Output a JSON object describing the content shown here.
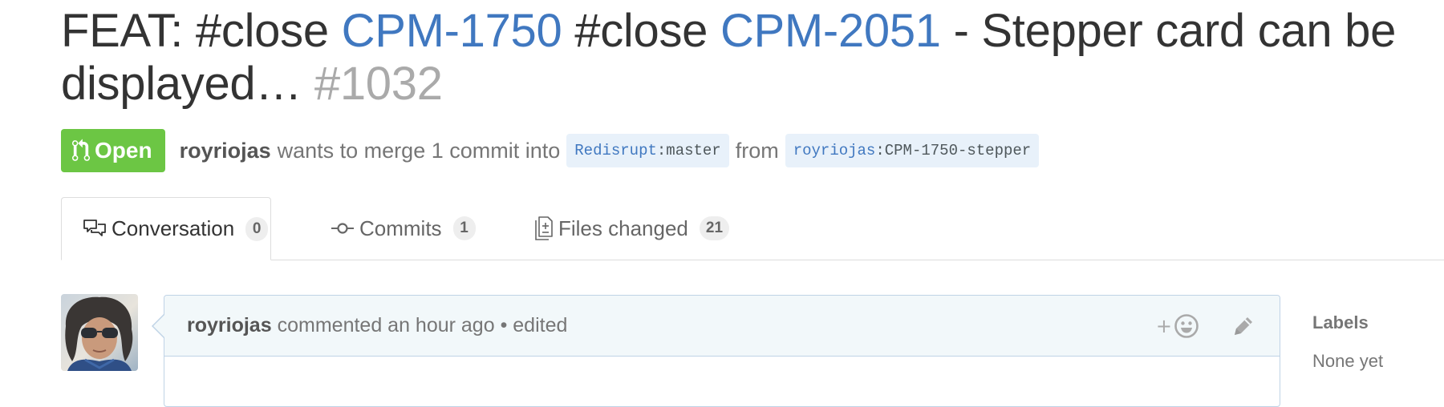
{
  "pull_request": {
    "title": {
      "part1": "FEAT: #close ",
      "link1": "CPM-1750",
      "part2": " #close ",
      "link2": "CPM-2051",
      "part3": " - Stepper card can be displayed…",
      "number": "#1032"
    },
    "state": {
      "label": "Open",
      "icon": "git-pull-request-icon",
      "color": "#6cc644"
    },
    "meta": {
      "author": "royriojas",
      "text_merge": "wants to merge 1 commit into",
      "base_user": "Redisrupt",
      "base_sep": ":",
      "base_branch": "master",
      "text_from": "from",
      "head_user": "royriojas",
      "head_sep": ":",
      "head_branch": "CPM-1750-stepper"
    }
  },
  "tabs": [
    {
      "label": "Conversation",
      "count": "0",
      "icon": "comment-discussion-icon",
      "selected": true
    },
    {
      "label": "Commits",
      "count": "1",
      "icon": "git-commit-icon",
      "selected": false
    },
    {
      "label": "Files changed",
      "count": "21",
      "icon": "file-diff-icon",
      "selected": false
    }
  ],
  "comment": {
    "author": "royriojas",
    "text": "commented an hour ago • edited",
    "reaction_icon": "smiley-icon",
    "reaction_plus": "+",
    "edit_icon": "pencil-icon"
  },
  "sidebar": {
    "labels_heading": "Labels",
    "labels_value": "None yet"
  },
  "colors": {
    "link": "#4078c0",
    "open_badge": "#6cc644",
    "comment_header_bg": "#f2f8fa",
    "comment_border": "#bfd3e6",
    "branch_bg": "#e8f1fa"
  }
}
